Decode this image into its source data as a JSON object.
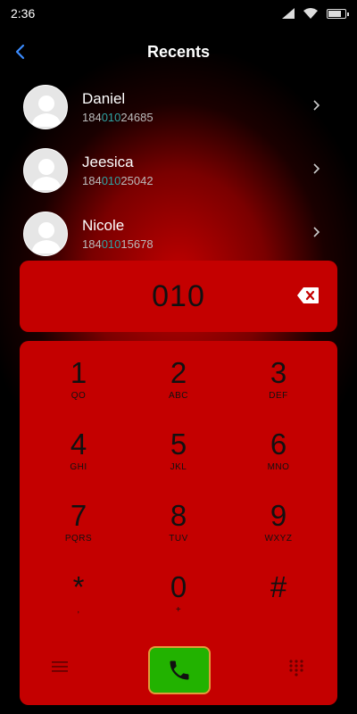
{
  "status": {
    "time": "2:36",
    "battery_level": 0.85
  },
  "header": {
    "title": "Recents",
    "back_icon": "chevron-left-icon"
  },
  "recents": [
    {
      "name": "Daniel",
      "num_pre": "184",
      "num_match": "010",
      "num_post": "24685"
    },
    {
      "name": "Jeesica",
      "num_pre": "184",
      "num_match": "010",
      "num_post": "25042"
    },
    {
      "name": "Nicole",
      "num_pre": "184",
      "num_match": "010",
      "num_post": "15678"
    }
  ],
  "dialer": {
    "number": "010",
    "keys": [
      {
        "digit": "1",
        "letters": "QO"
      },
      {
        "digit": "2",
        "letters": "ABC"
      },
      {
        "digit": "3",
        "letters": "DEF"
      },
      {
        "digit": "4",
        "letters": "GHI"
      },
      {
        "digit": "5",
        "letters": "JKL"
      },
      {
        "digit": "6",
        "letters": "MNO"
      },
      {
        "digit": "7",
        "letters": "PQRS"
      },
      {
        "digit": "8",
        "letters": "TUV"
      },
      {
        "digit": "9",
        "letters": "WXYZ"
      },
      {
        "digit": "*",
        "letters": ","
      },
      {
        "digit": "0",
        "letters": "+"
      },
      {
        "digit": "#",
        "letters": ""
      }
    ]
  },
  "colors": {
    "panel": "#c40000",
    "call_button": "#22b200",
    "call_border": "#e39a3b",
    "match_highlight": "#2fa3a3"
  }
}
